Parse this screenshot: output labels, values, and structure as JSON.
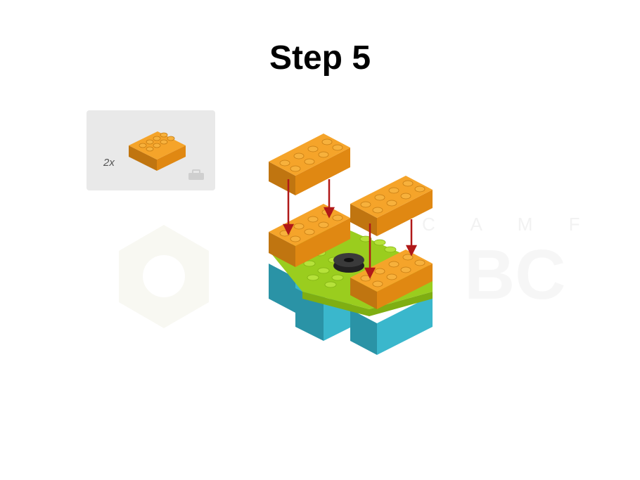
{
  "page": {
    "title": "Step 5"
  },
  "parts": {
    "quantity": "2x",
    "part_name": "2x4 brick",
    "color": "#E8961C"
  },
  "watermark": {
    "text_top": "C A M F",
    "text_main": "BC"
  },
  "colors": {
    "orange": "#E8961C",
    "lime": "#9ACD1E",
    "teal": "#36AFC4",
    "arrow": "#B01818",
    "panel": "#E9E9E9"
  },
  "icons": [
    "box-icon",
    "arrow-icon",
    "watermark-hexagon-icon"
  ]
}
